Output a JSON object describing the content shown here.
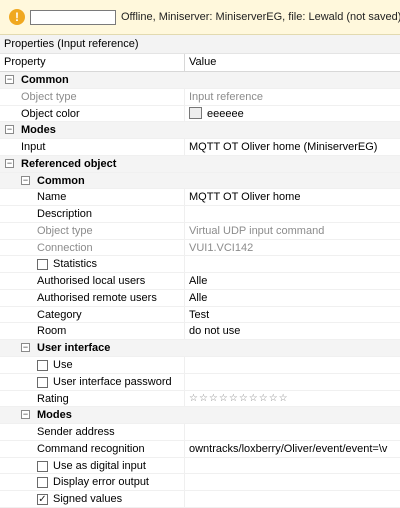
{
  "status": {
    "field_value": "",
    "text": "Offline, Miniserver: MiniserverEG, file: Lewald (not saved)"
  },
  "panel_title": "Properties (Input reference)",
  "columns": {
    "property": "Property",
    "value": "Value"
  },
  "rows": {
    "common1": {
      "label": "Common",
      "toggle": "⊟"
    },
    "object_type": {
      "label": "Object type",
      "value": "Input reference"
    },
    "object_color": {
      "label": "Object color",
      "value": "eeeeee",
      "color": "#eeeeee"
    },
    "modes1": {
      "label": "Modes",
      "toggle": "⊟"
    },
    "input": {
      "label": "Input",
      "value": "MQTT OT Oliver home (MiniserverEG)"
    },
    "ref_obj": {
      "label": "Referenced object",
      "toggle": "⊟"
    },
    "common2": {
      "label": "Common",
      "toggle": "⊟"
    },
    "name": {
      "label": "Name",
      "value": "MQTT OT Oliver home"
    },
    "description": {
      "label": "Description",
      "value": ""
    },
    "ref_object_type": {
      "label": "Object type",
      "value": "Virtual UDP input command"
    },
    "connection": {
      "label": "Connection",
      "value": "VUI1.VCI142"
    },
    "statistics": {
      "label": "Statistics",
      "checked": false
    },
    "auth_local": {
      "label": "Authorised local users",
      "value": "Alle"
    },
    "auth_remote": {
      "label": "Authorised remote users",
      "value": "Alle"
    },
    "category": {
      "label": "Category",
      "value": "Test"
    },
    "room": {
      "label": "Room",
      "value": "do not use"
    },
    "user_interface": {
      "label": "User interface",
      "toggle": "⊟"
    },
    "use": {
      "label": "Use",
      "checked": false
    },
    "ui_password": {
      "label": "User interface password",
      "checked": false
    },
    "rating": {
      "label": "Rating",
      "value": "☆☆☆☆☆☆☆☆☆☆",
      "stars": 0
    },
    "modes2": {
      "label": "Modes",
      "toggle": "⊟"
    },
    "sender_address": {
      "label": "Sender address",
      "value": ""
    },
    "command_recognition": {
      "label": "Command recognition",
      "value": "owntracks/loxberry/Oliver/event/event=\\v"
    },
    "digital_input": {
      "label": "Use as digital input",
      "checked": false
    },
    "display_error": {
      "label": "Display error output",
      "checked": false
    },
    "signed_values": {
      "label": "Signed values",
      "checked": true,
      "mark": "✓"
    }
  }
}
